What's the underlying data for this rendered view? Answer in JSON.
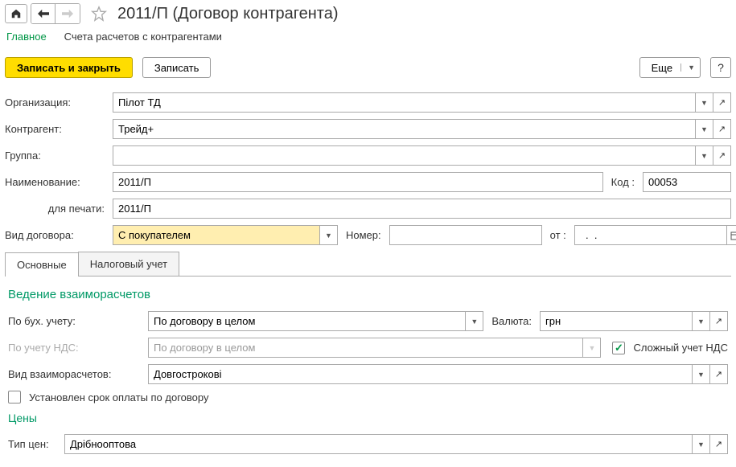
{
  "header": {
    "title": "2011/П (Договор контрагента)"
  },
  "subnav": {
    "main": "Главное",
    "accounts": "Счета расчетов с контрагентами"
  },
  "toolbar": {
    "save_close": "Записать и закрыть",
    "save": "Записать",
    "more": "Еще",
    "help": "?"
  },
  "fields": {
    "org_label": "Организация:",
    "org_value": "Пілот ТД",
    "counterparty_label": "Контрагент:",
    "counterparty_value": "Трейд+",
    "group_label": "Группа:",
    "group_value": "",
    "name_label": "Наименование:",
    "name_value": "2011/П",
    "code_label": "Код :",
    "code_value": "00053",
    "print_label": "для печати:",
    "print_value": "2011/П",
    "contract_type_label": "Вид договора:",
    "contract_type_value": "С покупателем",
    "number_label": "Номер:",
    "number_value": "",
    "from_label": "от    :",
    "from_value": "  .  .    "
  },
  "tabs": {
    "main": "Основные",
    "tax": "Налоговый учет"
  },
  "settlements": {
    "title": "Ведение взаиморасчетов",
    "acct_label": "По бух. учету:",
    "acct_value": "По договору в целом",
    "currency_label": "Валюта:",
    "currency_value": "грн",
    "vat_acct_label": "По учету НДС:",
    "vat_acct_value": "По договору в целом",
    "complex_vat_label": "Сложный  учет НДС",
    "settlement_type_label": "Вид взаиморасчетов:",
    "settlement_type_value": "Довгострокові",
    "payment_term_label": "Установлен срок оплаты по договору"
  },
  "prices": {
    "title": "Цены",
    "price_type_label": "Тип цен:",
    "price_type_value": "Дрібнооптова"
  }
}
